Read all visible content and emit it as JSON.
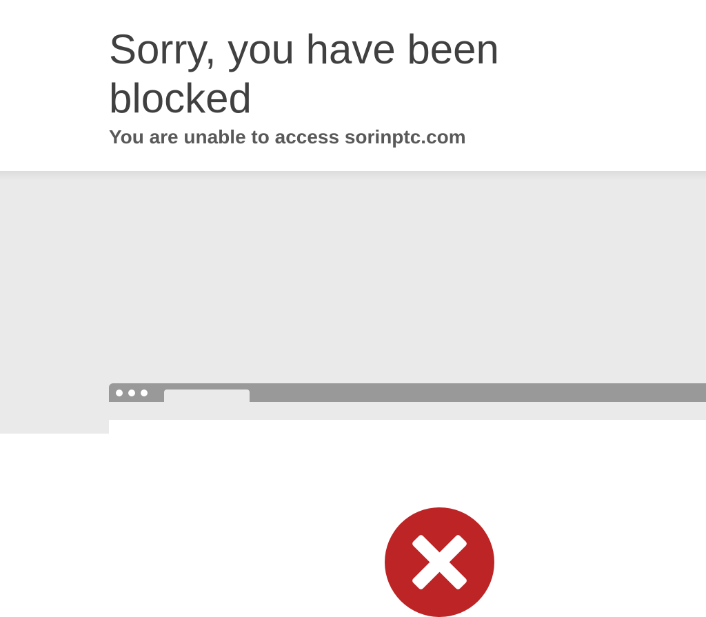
{
  "header": {
    "title": "Sorry, you have been blocked",
    "subtitle": "You are unable to access sorinptc.com"
  },
  "illustration": {
    "window_dots": [
      "dot",
      "dot",
      "dot"
    ],
    "icon": "error-x-icon",
    "icon_color": "#bd2426"
  },
  "colors": {
    "title_text": "#404040",
    "subtitle_text": "#595959",
    "band_background": "#eaeaea",
    "browser_bar": "#999999"
  }
}
